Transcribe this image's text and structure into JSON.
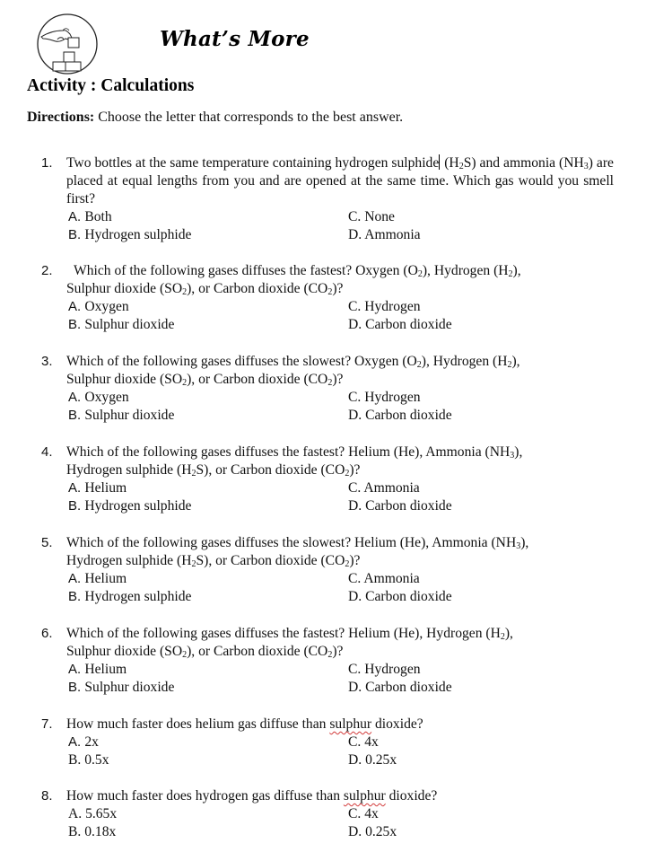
{
  "header": {
    "logo_icon": "hand-stacking-blocks-icon",
    "title": "What’s More"
  },
  "activity": {
    "label": "Activity : Calculations"
  },
  "directions": {
    "label": "Directions:",
    "text": " Choose the letter that corresponds to the best answer."
  },
  "questions": [
    {
      "number": "1.",
      "stem_parts": [
        "Two bottles at the same temperature containing hydrogen sulphide",
        " (H",
        "2",
        "S) and ammonia (NH",
        "3",
        ") are placed at equal lengths from you and are opened at the same time. Which gas would you smell first?"
      ],
      "options": {
        "A": "Both",
        "B": "Hydrogen sulphide",
        "C": "None",
        "D": "Ammonia"
      }
    },
    {
      "number": "2.",
      "stem_parts": [
        "Which of the following gases diffuses the fastest? Oxygen (O",
        "2",
        "), Hydrogen (H",
        "2",
        "),",
        "Sulphur dioxide (SO",
        "2",
        "), or Carbon dioxide (CO",
        "2",
        ")?"
      ],
      "options": {
        "A": "Oxygen",
        "B": "Sulphur dioxide",
        "C": "Hydrogen",
        "D": "Carbon dioxide"
      }
    },
    {
      "number": "3.",
      "stem_parts": [
        "Which of the following gases diffuses the slowest? Oxygen (O",
        "2",
        "), Hydrogen (H",
        "2",
        "),",
        "Sulphur dioxide (SO",
        "2",
        "), or Carbon dioxide (CO",
        "2",
        ")?"
      ],
      "options": {
        "A": "Oxygen",
        "B": "Sulphur dioxide",
        "C": "Hydrogen",
        "D": "Carbon dioxide"
      }
    },
    {
      "number": "4.",
      "stem_parts": [
        "Which of the following gases diffuses the fastest? Helium (He), Ammonia (NH",
        "3",
        "),",
        "Hydrogen sulphide (H",
        "2",
        "S), or Carbon dioxide (CO",
        "2",
        ")?"
      ],
      "options": {
        "A": "Helium",
        "B": "Hydrogen sulphide",
        "C": "Ammonia",
        "D": "Carbon dioxide"
      }
    },
    {
      "number": "5.",
      "stem_parts": [
        "Which of the following gases diffuses the slowest? Helium (He), Ammonia (NH",
        "3",
        "),",
        "Hydrogen sulphide (H",
        "2",
        "S), or Carbon dioxide (CO",
        "2",
        ")?"
      ],
      "options": {
        "A": "Helium",
        "B": "Hydrogen sulphide",
        "C": "Ammonia",
        "D": "Carbon dioxide"
      }
    },
    {
      "number": "6.",
      "stem_parts": [
        "Which of the following gases diffuses the fastest? Helium (He), Hydrogen (H",
        "2",
        "),",
        "Sulphur dioxide (SO",
        "2",
        "), or Carbon dioxide (CO",
        "2",
        ")?"
      ],
      "options": {
        "A": "Helium",
        "B": "Sulphur dioxide",
        "C": "Hydrogen",
        "D": "Carbon dioxide"
      }
    },
    {
      "number": "7.",
      "stem_parts": [
        "How much faster does helium gas diffuse than ",
        "sulphur",
        " dioxide?"
      ],
      "options": {
        "A": "2x",
        "B": "0.5x",
        "C": "4x",
        "D": "0.25x"
      }
    },
    {
      "number": "8.",
      "stem_parts": [
        "How much faster does hydrogen gas diffuse than ",
        "sulphur",
        " dioxide?"
      ],
      "options": {
        "A": "5.65x",
        "B": "0.18x",
        "C": "4x",
        "D": "0.25x"
      }
    }
  ],
  "option_letters": {
    "A": "A. ",
    "B": "B. ",
    "C": "C. ",
    "D": "D. "
  },
  "colors": {
    "spellcheck_underline": "#d23a3a",
    "text": "#111111"
  }
}
